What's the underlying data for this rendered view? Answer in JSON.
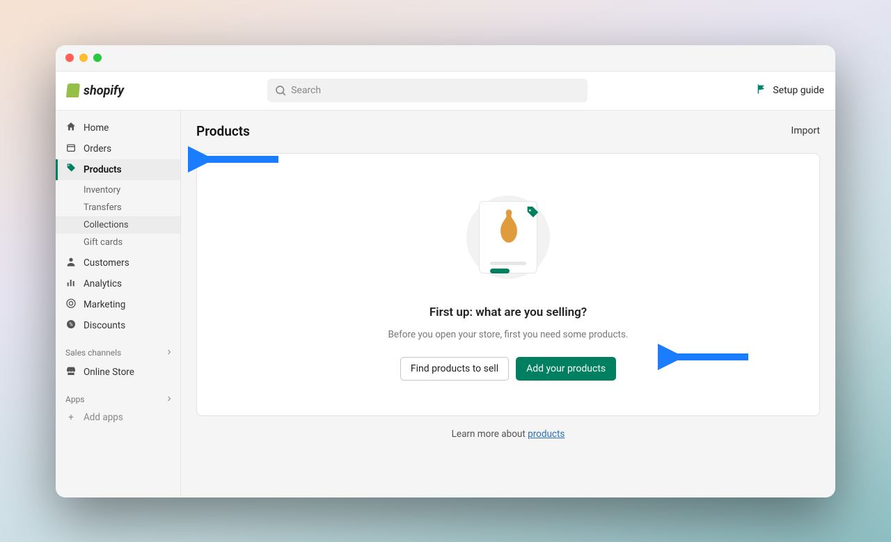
{
  "brand": "shopify",
  "search": {
    "placeholder": "Search"
  },
  "header": {
    "setup_guide": "Setup guide"
  },
  "sidebar": {
    "items": [
      {
        "label": "Home"
      },
      {
        "label": "Orders"
      },
      {
        "label": "Products",
        "active": true
      },
      {
        "label": "Customers"
      },
      {
        "label": "Analytics"
      },
      {
        "label": "Marketing"
      },
      {
        "label": "Discounts"
      }
    ],
    "products_sub": [
      {
        "label": "Inventory"
      },
      {
        "label": "Transfers"
      },
      {
        "label": "Collections",
        "selected": true
      },
      {
        "label": "Gift cards"
      }
    ],
    "sales_channels_label": "Sales channels",
    "online_store": "Online Store",
    "apps_label": "Apps",
    "add_apps": "Add apps"
  },
  "page": {
    "title": "Products",
    "import": "Import",
    "empty_title": "First up: what are you selling?",
    "empty_sub": "Before you open your store, first you need some products.",
    "find_btn": "Find products to sell",
    "add_btn": "Add your products",
    "learn_prefix": "Learn more about ",
    "learn_link": "products"
  }
}
